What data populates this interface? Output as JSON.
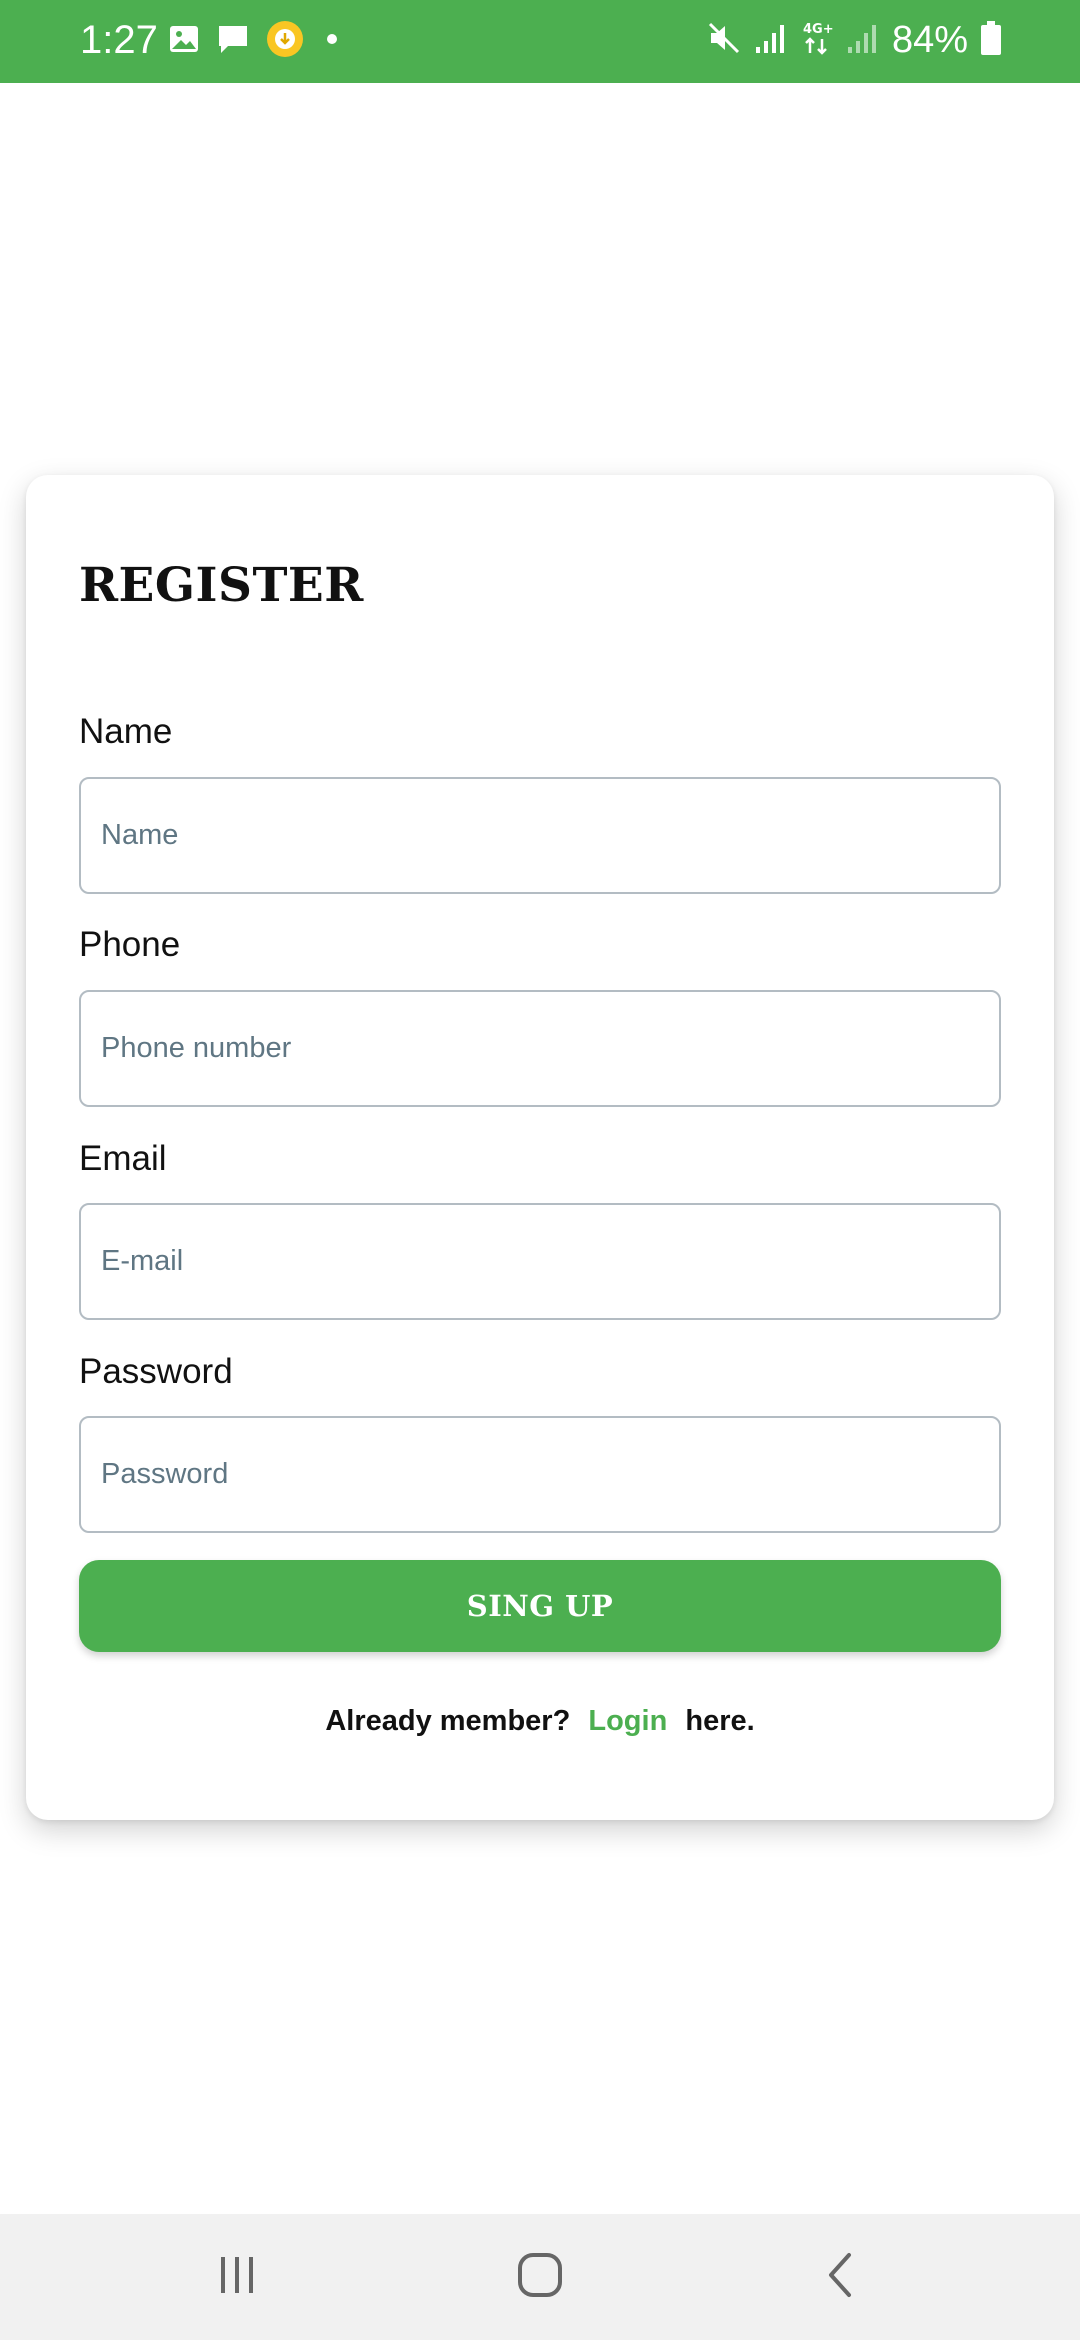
{
  "status_bar": {
    "time": "1:27",
    "battery": "84%",
    "left_icons": [
      "gallery-icon",
      "message-icon",
      "download-badge-icon",
      "notification-dot-icon"
    ],
    "right_icons": [
      "mute-icon",
      "signal-icon",
      "4g-data-icon",
      "signal-weak-icon",
      "battery-icon"
    ],
    "color": "#4caf50"
  },
  "form": {
    "title": "REGISTER",
    "fields": [
      {
        "label": "Name",
        "placeholder": "Name",
        "value": ""
      },
      {
        "label": "Phone",
        "placeholder": "Phone number",
        "value": ""
      },
      {
        "label": "Email",
        "placeholder": "E-mail",
        "value": ""
      },
      {
        "label": "Password",
        "placeholder": "Password",
        "value": ""
      }
    ],
    "submit_label": "SING UP",
    "login_prompt": "Already member?",
    "login_link": "Login",
    "login_suffix": "here.",
    "accent_color": "#4caf50"
  },
  "nav_bar": {
    "buttons": [
      "recent-apps-icon",
      "home-icon",
      "back-icon"
    ]
  }
}
